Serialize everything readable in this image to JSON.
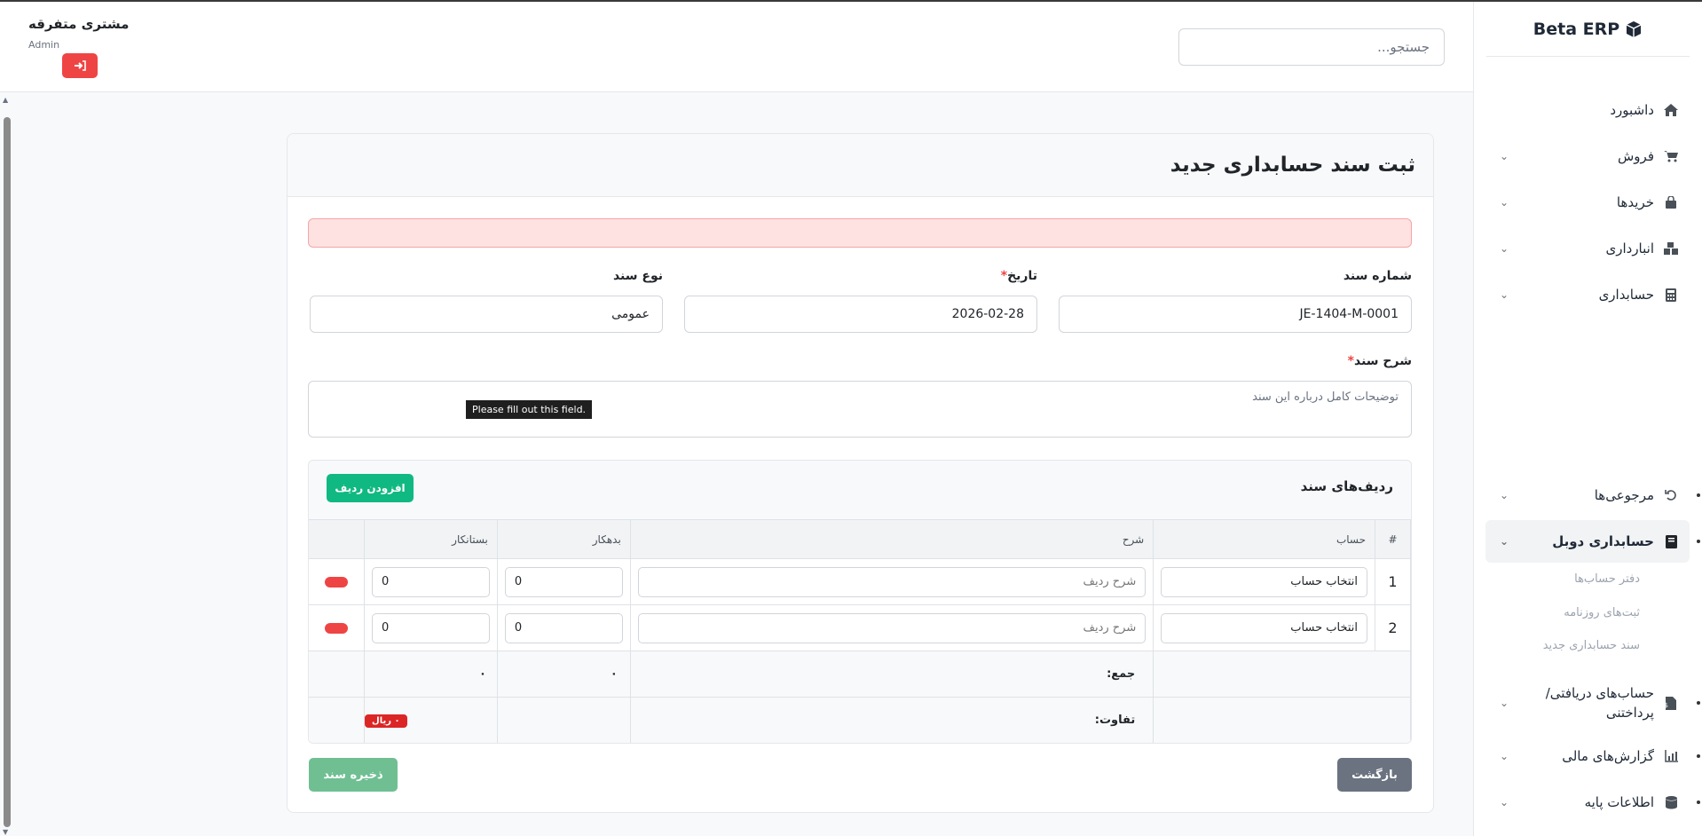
{
  "brand": {
    "name": "Beta ERP",
    "icon": "cube-icon"
  },
  "sidebar": {
    "items": [
      {
        "label": "داشبورد",
        "icon": "home-icon",
        "has_children": false
      },
      {
        "label": "فروش",
        "icon": "cart-icon",
        "has_children": true
      },
      {
        "label": "خریدها",
        "icon": "bag-icon",
        "has_children": true
      },
      {
        "label": "انبارداری",
        "icon": "boxes-icon",
        "has_children": true
      },
      {
        "label": "حسابداری",
        "icon": "calculator-icon",
        "has_children": true
      },
      {
        "label": "مرجوعی‌ها",
        "icon": "undo-icon",
        "has_children": true
      },
      {
        "label": "حسابداری دوبل",
        "icon": "book-icon",
        "has_children": true,
        "active": true
      },
      {
        "label": "حساب‌های دریافتی/ پرداختنی",
        "icon": "invoice-icon",
        "has_children": true
      },
      {
        "label": "گزارش‌های مالی",
        "icon": "chart-icon",
        "has_children": true
      },
      {
        "label": "اطلاعات پایه",
        "icon": "database-icon",
        "has_children": true
      }
    ],
    "sub_items": [
      "دفتر حساب‌ها",
      "ثبت‌های روزنامه",
      "سند حسابداری جدید"
    ]
  },
  "header": {
    "search_placeholder": "جستجو...",
    "user_name": "مشتری متفرقه",
    "user_role": "Admin"
  },
  "form": {
    "title": "ثبت سند حسابداری جدید",
    "doc_number_label": "شماره سند",
    "doc_number_value": "JE-1404-M-0001",
    "date_label": "تاریخ",
    "date_value": "2026-02-28",
    "doc_type_label": "نوع سند",
    "doc_type_value": "عمومی",
    "description_label": "شرح سند",
    "description_placeholder": "توضیحات کامل درباره این سند",
    "tooltip": "Please fill out this field."
  },
  "rows": {
    "title": "ردیف‌های سند",
    "add_button": "افزودن ردیف",
    "columns": [
      "#",
      "حساب",
      "شرح",
      "بدهکار",
      "بستانکار"
    ],
    "lines": [
      {
        "num": "1",
        "account": "انتخاب حساب",
        "description_placeholder": "شرح ردیف",
        "debit": "0",
        "credit": "0"
      },
      {
        "num": "2",
        "account": "انتخاب حساب",
        "description_placeholder": "شرح ردیف",
        "debit": "0",
        "credit": "0"
      }
    ],
    "sum_label": "جمع:",
    "sum_debit": "۰",
    "sum_credit": "۰",
    "diff_label": "تفاوت:",
    "diff_value": "۰ ریال"
  },
  "actions": {
    "back": "بازگشت",
    "save": "ذخیره سند"
  },
  "colors": {
    "primary_green": "#10b981",
    "danger": "#ef4444",
    "alert_bg": "#fee2e2"
  }
}
